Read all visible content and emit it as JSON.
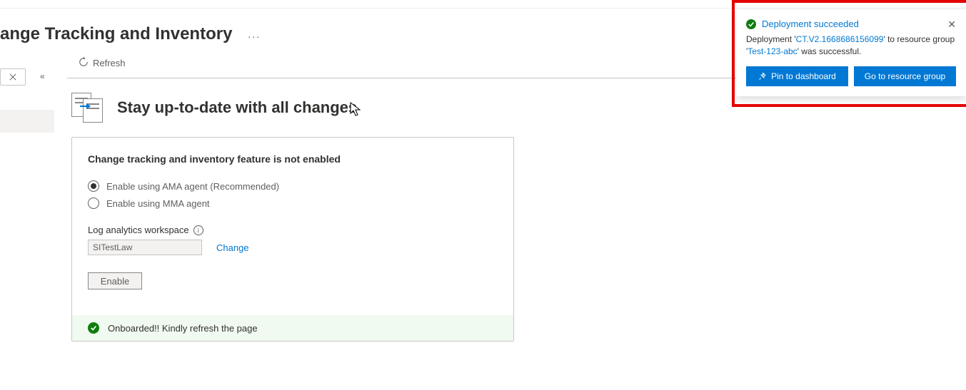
{
  "header": {
    "title": "ange Tracking and Inventory",
    "ellipsis": "..."
  },
  "toolbar": {
    "refresh_label": "Refresh"
  },
  "main": {
    "heading": "Stay up-to-date with all changes",
    "card": {
      "title": "Change tracking and inventory feature is not enabled",
      "radio_ama": "Enable using AMA agent (Recommended)",
      "radio_mma": "Enable using MMA agent",
      "workspace_label": "Log analytics workspace",
      "workspace_value": "SITestLaw",
      "change_link": "Change",
      "enable_button": "Enable",
      "status_message": "Onboarded!! Kindly refresh the page"
    }
  },
  "toast": {
    "title": "Deployment succeeded",
    "body_prefix": "Deployment '",
    "deployment_name": "CT.V2.1668686156099",
    "body_mid": "' to resource group '",
    "resource_group": "Test-123-abc",
    "body_suffix": "' was successful.",
    "pin_label": "Pin to dashboard",
    "goto_label": "Go to resource group"
  }
}
